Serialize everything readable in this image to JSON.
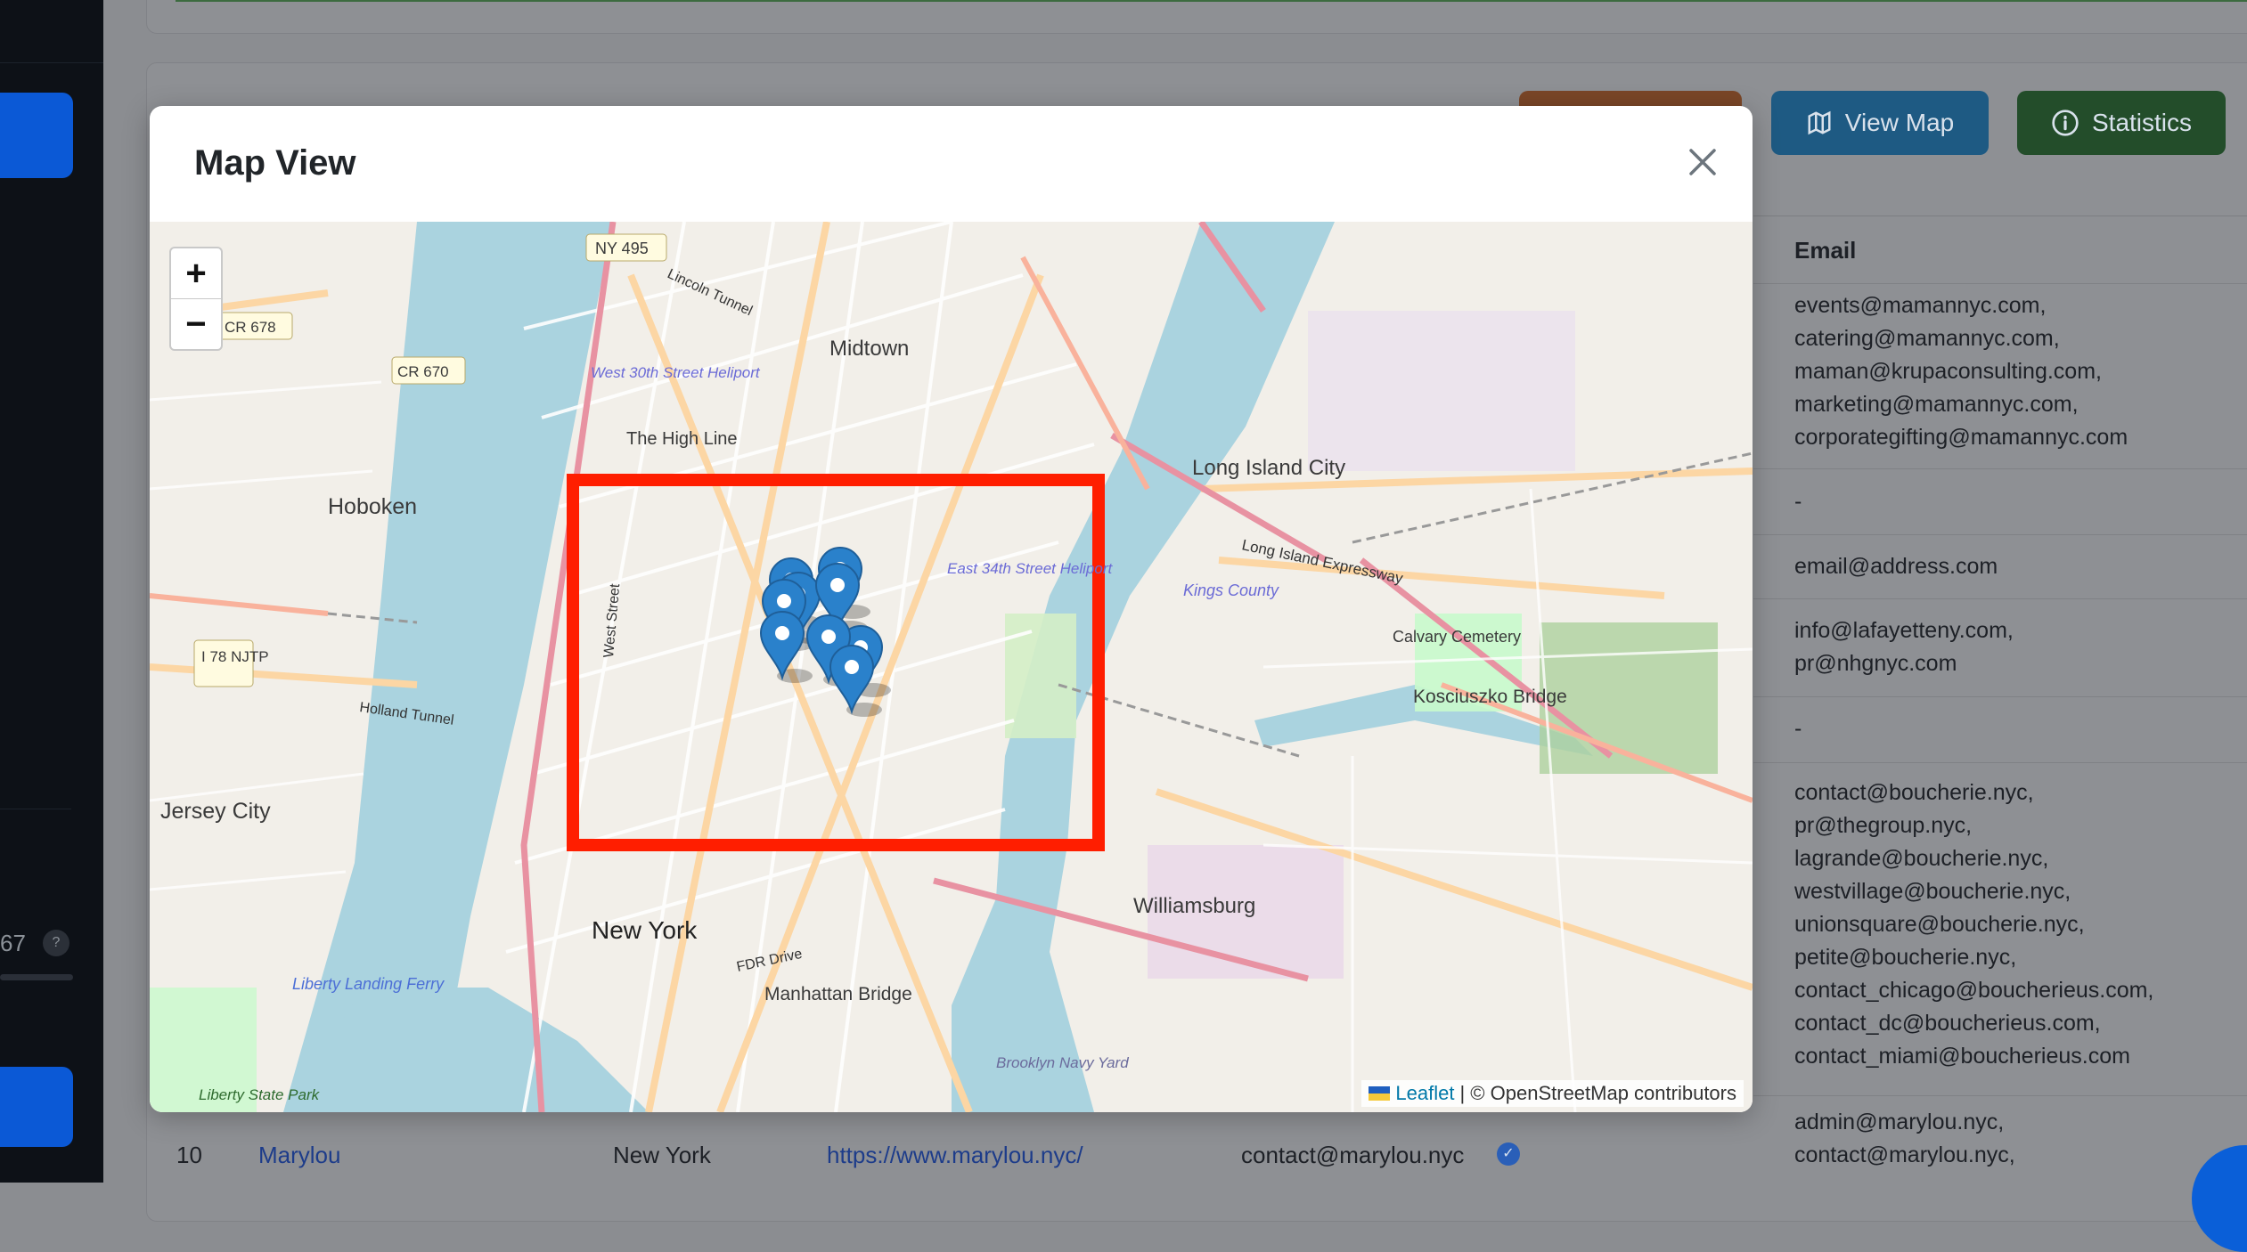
{
  "sidebar": {
    "count_text": "67",
    "help_label": "?"
  },
  "toolbar": {
    "view_map_label": "View Map",
    "statistics_label": "Statistics"
  },
  "table": {
    "email_header": "Email",
    "emails": [
      "events@mamannyc.com,\ncatering@mamannyc.com,\nmaman@krupaconsulting.com,\nmarketing@mamannyc.com,\ncorporategifting@mamannyc.com",
      "-",
      "email@address.com",
      "info@lafayetteny.com,\npr@nhgnyc.com",
      "-",
      "contact@boucherie.nyc,\npr@thegroup.nyc,\nlagrande@boucherie.nyc,\nwestvillage@boucherie.nyc,\nunionsquare@boucherie.nyc,\npetite@boucherie.nyc,\ncontact_chicago@boucherieus.com,\ncontact_dc@boucherieus.com,\ncontact_miami@boucherieus.com",
      "admin@marylou.nyc,\ncontact@marylou.nyc,"
    ],
    "bottom_row": {
      "index": "10",
      "name": "Marylou",
      "city": "New York",
      "url": "https://www.marylou.nyc/",
      "email": "contact@marylou.nyc"
    }
  },
  "modal": {
    "title": "Map View",
    "close_label": "×",
    "zoom_in_label": "+",
    "zoom_out_label": "−",
    "attribution": {
      "leaflet": "Leaflet",
      "rest": "| © OpenStreetMap contributors"
    },
    "map_labels": {
      "midtown": "Midtown",
      "hoboken": "Hoboken",
      "jersey_city": "Jersey City",
      "new_york": "New York",
      "long_island_city": "Long Island City",
      "williamsburg": "Williamsburg",
      "manhattan_bridge": "Manhattan Bridge",
      "kosciuszko": "Kosciuszko Bridge",
      "high_line": "The High Line",
      "west_30th": "West 30th Street Heliport",
      "east_34th": "East 34th Street Heliport",
      "calvary": "Calvary Cemetery",
      "ny495": "NY 495",
      "cr678": "CR 678",
      "cr670": "CR 670",
      "i78": "I 78 NJTP",
      "holland": "Holland Tunnel",
      "lincoln": "Lincoln Tunnel",
      "liberty_sp": "Liberty State Park",
      "liberty_ferry": "Liberty Landing Ferry",
      "bk_navy": "Brooklyn Navy Yard",
      "lie": "Long Island Expressway",
      "kings": "Kings County",
      "fdr": "FDR Drive",
      "west_street": "West Street"
    },
    "marker_count": 9
  },
  "colors": {
    "highlight": "#ff1e00",
    "marker": "#2a81cb",
    "water": "#aad3df",
    "park": "#c8facc"
  }
}
